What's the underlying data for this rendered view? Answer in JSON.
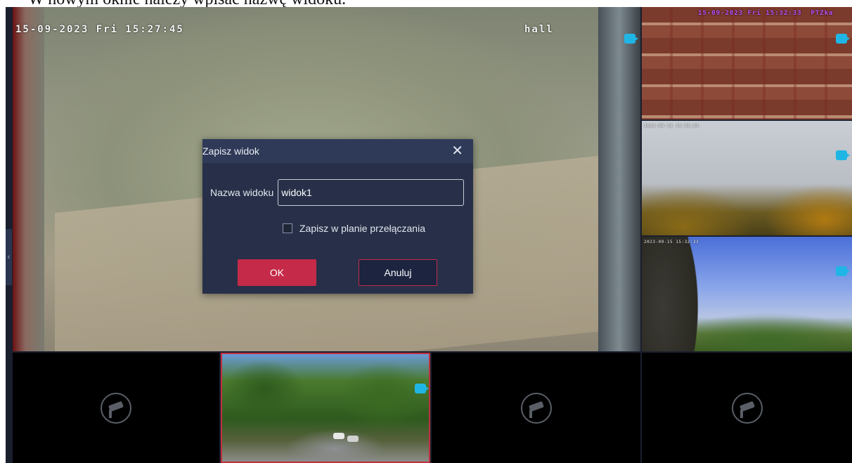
{
  "caption": "W nowym oknie należy wpisać nazwę widoku.",
  "main_camera": {
    "timestamp": "15-09-2023 Fri 15:27:45",
    "name": "hall"
  },
  "side_cameras": [
    {
      "timestamp": "15-09-2023 Fri 15:32:33",
      "name": "PTZka"
    },
    {
      "timestamp": "2023-09-15 15:32:33"
    },
    {
      "timestamp": "2023-09-15 15:32:33"
    }
  ],
  "icons": {
    "camera_status": "video-camera-icon",
    "empty_slot": "camera-off-icon",
    "close": "close-icon",
    "collapse": "chevron-left-icon"
  },
  "colors": {
    "accent": "#c52a48",
    "dialog_bg": "#273048",
    "camera_badge": "#1fb6e6"
  },
  "dialog": {
    "title": "Zapisz widok",
    "close_glyph": "✕",
    "name_label": "Nazwa widoku",
    "name_value": "widok1",
    "checkbox_label": "Zapisz w planie przełączania",
    "checkbox_checked": false,
    "ok_label": "OK",
    "cancel_label": "Anuluj"
  },
  "collapse_glyph": "‹"
}
